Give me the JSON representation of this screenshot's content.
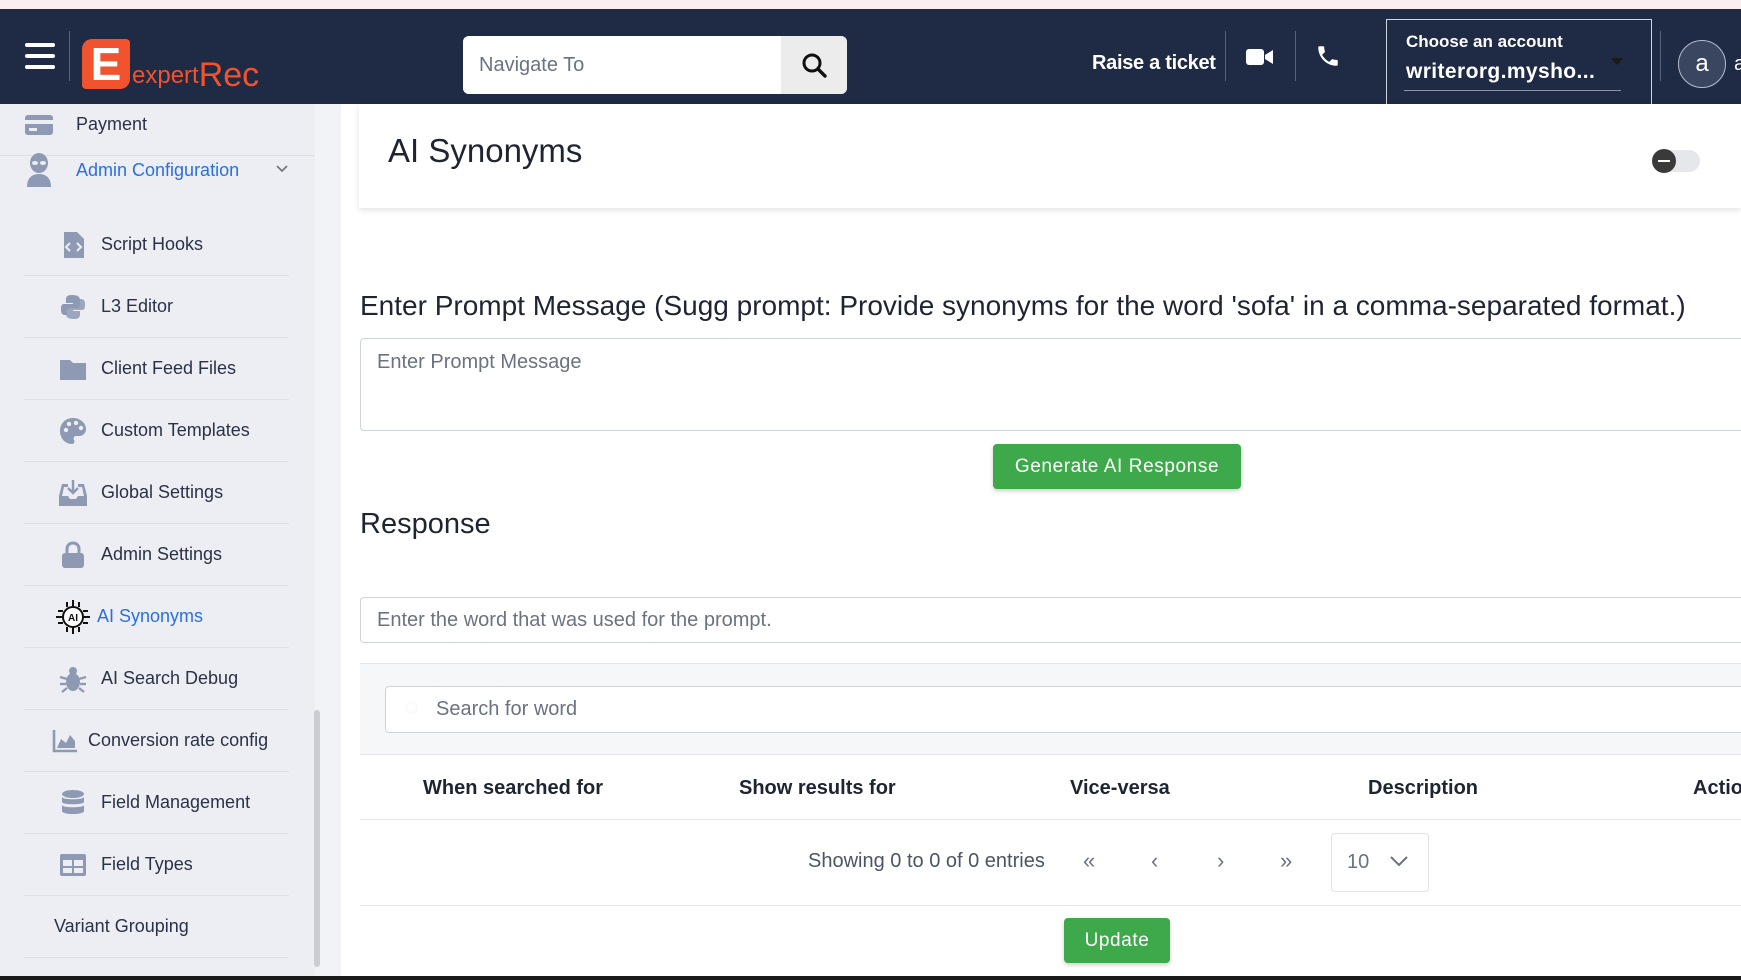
{
  "header": {
    "logo_letter": "E",
    "logo_text_small": "expert",
    "logo_text_large": "Rec",
    "nav_placeholder": "Navigate To",
    "raise_ticket": "Raise a ticket",
    "account_label": "Choose an account",
    "account_value": "writerorg.mysho...",
    "avatar_letter": "a",
    "avatar_tail": "a"
  },
  "sidebar": {
    "payment": "Payment",
    "admin_configuration": "Admin Configuration",
    "items": [
      {
        "label": "Script Hooks",
        "icon": "code-file-icon"
      },
      {
        "label": "L3 Editor",
        "icon": "python-icon"
      },
      {
        "label": "Client Feed Files",
        "icon": "folder-icon"
      },
      {
        "label": "Custom Templates",
        "icon": "palette-icon"
      },
      {
        "label": "Global Settings",
        "icon": "inbox-icon"
      },
      {
        "label": "Admin Settings",
        "icon": "lock-icon"
      },
      {
        "label": "AI Synonyms",
        "icon": "ai-chip-icon"
      },
      {
        "label": "AI Search Debug",
        "icon": "bug-icon"
      },
      {
        "label": "Conversion rate config",
        "icon": "area-chart-icon"
      },
      {
        "label": "Field Management",
        "icon": "database-icon"
      },
      {
        "label": "Field Types",
        "icon": "table-icon"
      },
      {
        "label": "Variant Grouping",
        "icon": ""
      }
    ]
  },
  "main": {
    "title": "AI Synonyms",
    "prompt_label": "Enter Prompt Message (Sugg prompt: Provide synonyms for the word 'sofa' in a comma-separated format.)",
    "prompt_placeholder": "Enter Prompt Message",
    "generate_button": "Generate AI Response",
    "response_title": "Response",
    "word_placeholder": "Enter the word that was used for the prompt.",
    "search_placeholder": "Search for word",
    "columns": [
      "When searched for",
      "Show results for",
      "Vice-versa",
      "Description",
      "Actio"
    ],
    "showing": "Showing 0 to 0 of 0 entries",
    "pager": {
      "first": "«",
      "prev": "‹",
      "next": "›",
      "last": "»"
    },
    "per_page": "10",
    "update_button": "Update"
  },
  "colors": {
    "header_bg": "#1f2a44",
    "brand": "#f0532d",
    "accent_blue": "#2a6fe0",
    "green": "#3ea94b",
    "sidebar_bg": "#eceef3"
  }
}
